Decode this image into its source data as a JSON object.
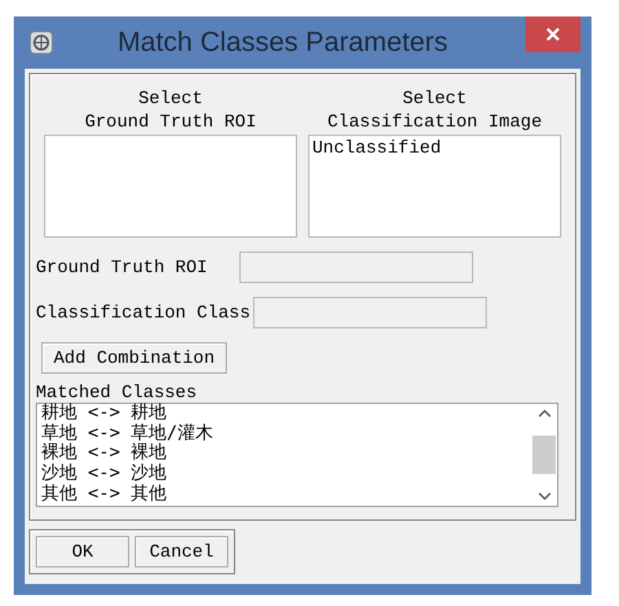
{
  "window": {
    "title": "Match Classes Parameters"
  },
  "ground_truth_list": {
    "label_lines": [
      "Select",
      "Ground Truth ROI"
    ]
  },
  "classification_list": {
    "label_lines": [
      "Select",
      "Classification Image"
    ],
    "items": [
      "Unclassified"
    ]
  },
  "fields": [
    {
      "label": "Ground Truth ROI"
    },
    {
      "label": "Classification Class"
    }
  ],
  "add_button": "Add Combination",
  "matched": {
    "label": "Matched Classes",
    "items": [
      "耕地 <-> 耕地",
      "草地 <-> 草地/灌木",
      "裸地 <-> 裸地",
      "沙地 <-> 沙地",
      "其他 <-> 其他"
    ]
  },
  "buttons": [
    "OK",
    "Cancel"
  ]
}
